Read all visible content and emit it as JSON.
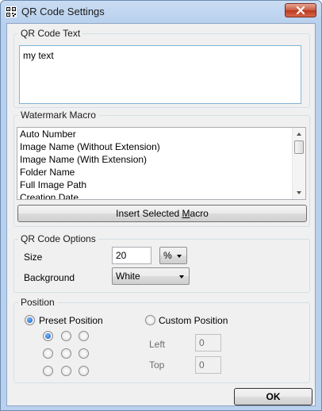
{
  "window": {
    "title": "QR Code Settings"
  },
  "qr_text": {
    "legend": "QR Code Text",
    "value": "my text"
  },
  "watermark": {
    "legend": "Watermark Macro",
    "items": [
      "Auto Number",
      "Image Name (Without Extension)",
      "Image Name (With Extension)",
      "Folder Name",
      "Full Image Path",
      "Creation Date"
    ],
    "insert_prefix": "Insert Selected ",
    "insert_mnemonic": "M",
    "insert_suffix": "acro"
  },
  "options": {
    "legend": "QR Code Options",
    "size_label": "Size",
    "size_value": "20",
    "unit": "%",
    "background_label": "Background",
    "background_value": "White"
  },
  "position": {
    "legend": "Position",
    "preset_label": "Preset Position",
    "custom_label": "Custom Position",
    "left_label": "Left",
    "left_value": "0",
    "top_label": "Top",
    "top_value": "0",
    "preset_selected": true,
    "grid_selected_index": 0
  },
  "footer": {
    "ok_label": "OK"
  }
}
